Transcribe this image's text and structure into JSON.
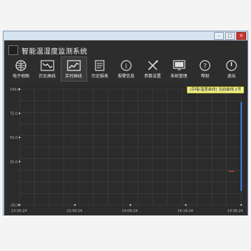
{
  "app": {
    "title": "智能温湿度监测系统"
  },
  "nav": {
    "items": [
      {
        "label": "电子地图",
        "icon": "globe-icon"
      },
      {
        "label": "历史曲线",
        "icon": "history-curve-icon"
      },
      {
        "label": "实时曲线",
        "icon": "realtime-curve-icon",
        "active": true
      },
      {
        "label": "历史报表",
        "icon": "report-icon"
      },
      {
        "label": "报警信息",
        "icon": "info-icon"
      },
      {
        "label": "参数设置",
        "icon": "tools-icon"
      },
      {
        "label": "系统管理",
        "icon": "monitor-icon"
      },
      {
        "label": "帮助",
        "icon": "help-icon"
      },
      {
        "label": "退出",
        "icon": "power-icon"
      }
    ]
  },
  "chart_data": {
    "type": "line",
    "legend": "[存储/温度曲线] 当前曲线:1号",
    "ylim": [
      -20,
      100
    ],
    "yticks": [
      100.0,
      75.0,
      50.0,
      25.0,
      -20.0
    ],
    "xticks": [
      "13:36:24",
      "13:56:24",
      "14:06:24",
      "14:16:24",
      "14:36:24"
    ],
    "series": [
      {
        "points": [
          [
            -20,
            75
          ],
          [
            100,
            75
          ]
        ]
      }
    ]
  },
  "colors": {
    "background": "#f4f4f4",
    "window_frame": "#d9e4f0",
    "app_bg": "#2d2d2d",
    "chart_bg": "#2b2b2b",
    "grid": "#444444",
    "legend_bg": "#f3f08e"
  }
}
